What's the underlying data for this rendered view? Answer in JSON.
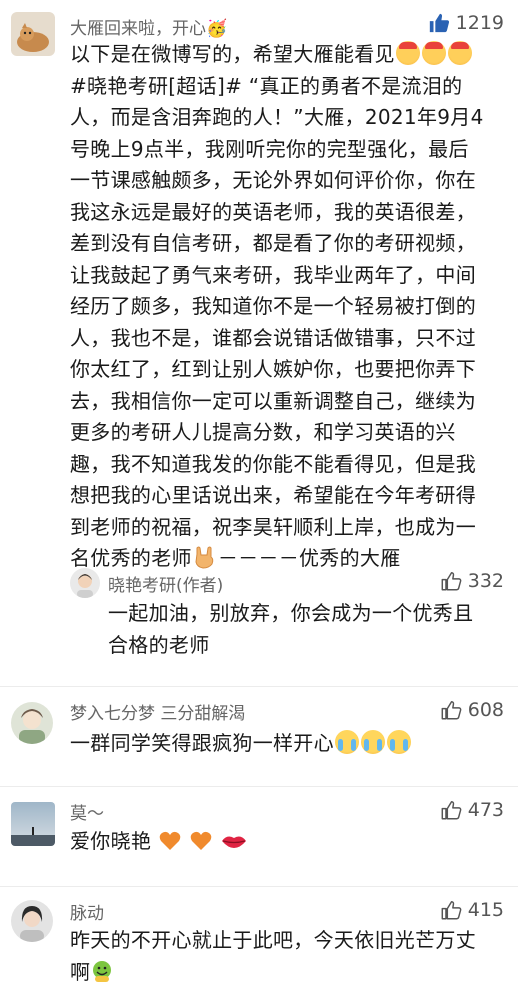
{
  "comments": [
    {
      "username": "大雁回来啦，开心🥳",
      "likes": "1219",
      "text_lines": [
        "以下是在微博写的，希望大雁能看见",
        "#晓艳考研[超话]# “真正的勇者不是流泪的",
        "人，而是含泪奔跑的人！”大雁，2021年9月4",
        "号晚上9点半，我刚听完你的完型强化，最后",
        "一节课感触颇多，无论外界如何评价你，你在",
        "我这永远是最好的英语老师，我的英语很差，",
        "差到没有自信考研，都是看了你的考研视频，",
        "让我鼓起了勇气来考研，我毕业两年了，中间",
        "经历了颇多，我知道你不是一个轻易被打倒的",
        "人，我也不是，谁都会说错话做错事，只不过",
        "你太红了，红到让别人嫉妒你，也要把你弄下",
        "去，我相信你一定可以重新调整自己，继续为",
        "更多的考研人儿提高分数，和学习英语的兴",
        "趣，我不知道我发的你能不能看得见，但是我",
        "想把我的心里话说出来，希望能在今年考研得",
        "到老师的祝福，祝李昊轩顺利上岸，也成为一",
        "名优秀的老师"
      ],
      "signature": "－－－－优秀的大雁",
      "reply": {
        "username": "晓艳考研(作者)",
        "likes": "332",
        "text_lines": [
          "一起加油，别放弃，你会成为一个优秀且",
          "合格的老师"
        ]
      }
    },
    {
      "username": "梦入七分梦 三分甜解渴",
      "likes": "608",
      "text": "一群同学笑得跟疯狗一样开心"
    },
    {
      "username": "莫～",
      "likes": "473",
      "text": "爱你晓艳"
    },
    {
      "username": "脉动",
      "likes": "415",
      "text_lines": [
        "昨天的不开心就止于此吧，今天依旧光芒万丈",
        "啊"
      ]
    }
  ],
  "colors": {
    "username": "#666666",
    "text": "#1a1a1a",
    "like_icon": "#2a62b3",
    "background": "#ffffff"
  },
  "icons": [
    "thumbs-up-icon",
    "thumbs-up-outline-icon"
  ]
}
